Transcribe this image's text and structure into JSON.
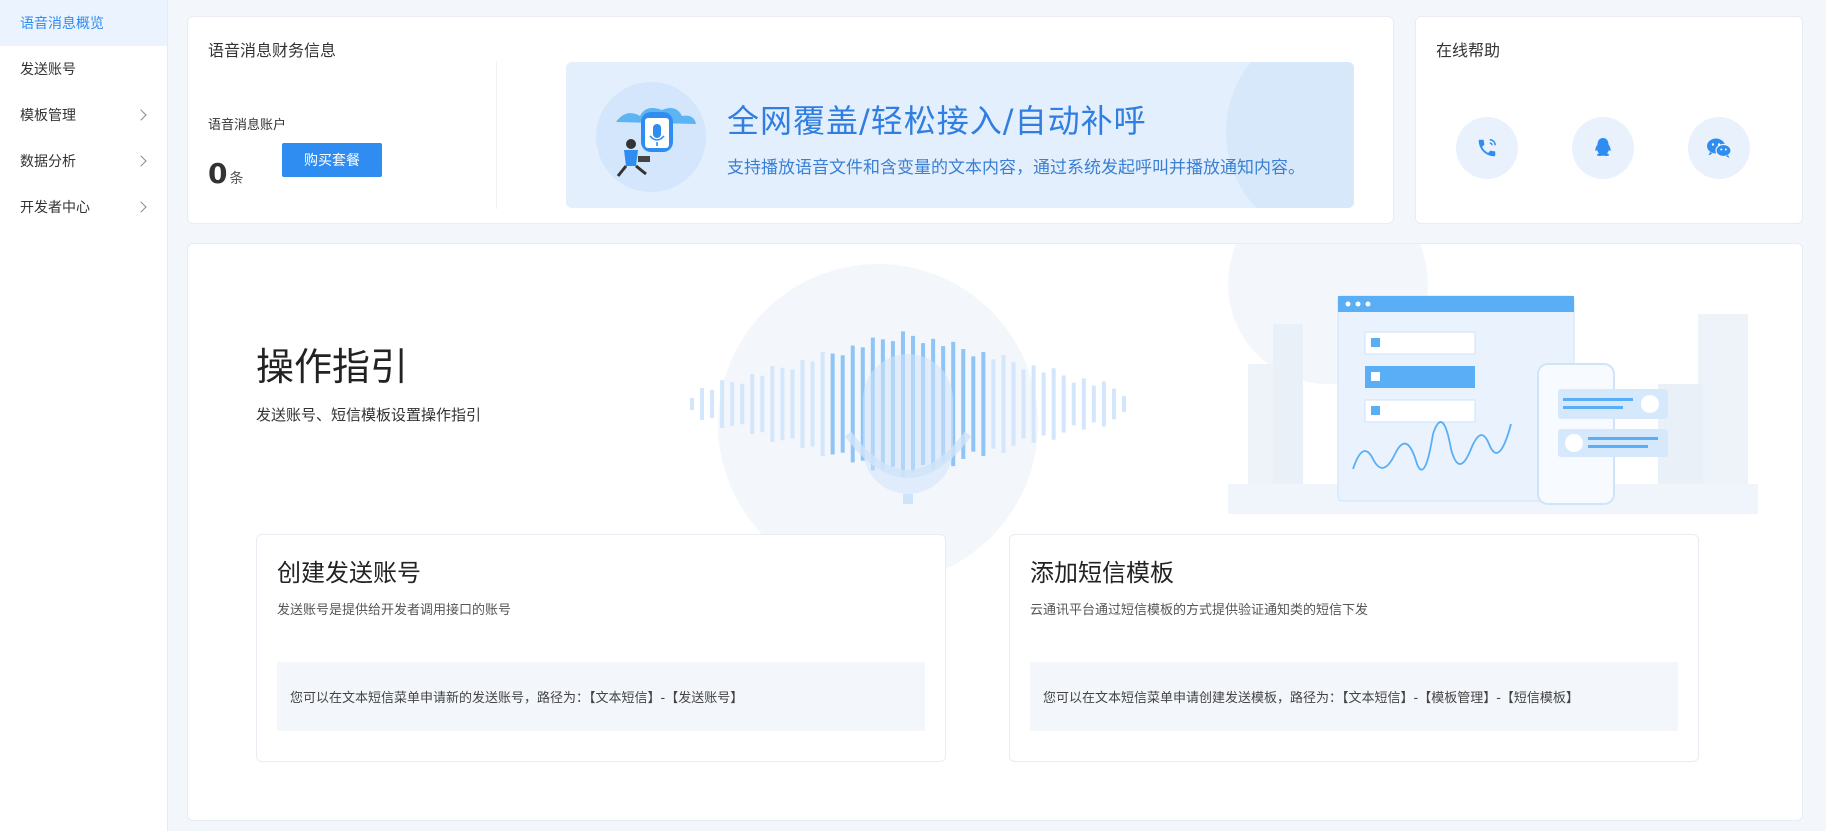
{
  "sidebar": {
    "items": [
      {
        "label": "语音消息概览",
        "active": true,
        "has_chevron": false
      },
      {
        "label": "发送账号",
        "active": false,
        "has_chevron": false
      },
      {
        "label": "模板管理",
        "active": false,
        "has_chevron": true
      },
      {
        "label": "数据分析",
        "active": false,
        "has_chevron": true
      },
      {
        "label": "开发者中心",
        "active": false,
        "has_chevron": true
      }
    ]
  },
  "finance": {
    "title": "语音消息财务信息",
    "account_label": "语音消息账户",
    "count": "0",
    "unit": "条",
    "buy_button": "购买套餐"
  },
  "banner": {
    "title": "全网覆盖/轻松接入/自动补呼",
    "subtitle": "支持播放语音文件和含变量的文本内容，通过系统发起呼叫并播放通知内容。"
  },
  "help": {
    "title": "在线帮助",
    "icons": [
      "phone-icon",
      "qq-icon",
      "wechat-icon"
    ]
  },
  "guide": {
    "title": "操作指引",
    "subtitle": "发送账号、短信模板设置操作指引",
    "steps": [
      {
        "title": "创建发送账号",
        "desc": "发送账号是提供给开发者调用接口的账号",
        "note": "您可以在文本短信菜单申请新的发送账号，路径为：【文本短信】-【发送账号】"
      },
      {
        "title": "添加短信模板",
        "desc": "云通讯平台通过短信模板的方式提供验证通知类的短信下发",
        "note": "您可以在文本短信菜单申请创建发送模板，路径为：【文本短信】-【模板管理】-【短信模板】"
      }
    ]
  },
  "colors": {
    "accent": "#2f8cf0",
    "banner_bg": "#e3effc",
    "page_bg": "#f3f6fa"
  }
}
